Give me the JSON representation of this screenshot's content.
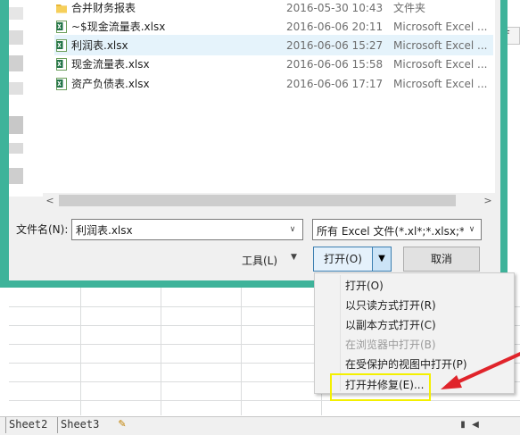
{
  "file_list": {
    "files": [
      {
        "name": "合并财务报表",
        "date": "2016-05-30 10:43",
        "type": "文件夹",
        "icon": "folder-icon"
      },
      {
        "name": "~$现金流量表.xlsx",
        "date": "2016-06-06 20:11",
        "type": "Microsoft Excel ...",
        "icon": "excel-file-icon"
      },
      {
        "name": "利润表.xlsx",
        "date": "2016-06-06 15:27",
        "type": "Microsoft Excel ...",
        "icon": "excel-file-icon"
      },
      {
        "name": "现金流量表.xlsx",
        "date": "2016-06-06 15:58",
        "type": "Microsoft Excel ...",
        "icon": "excel-file-icon"
      },
      {
        "name": "资产负债表.xlsx",
        "date": "2016-06-06 17:17",
        "type": "Microsoft Excel ...",
        "icon": "excel-file-icon"
      }
    ],
    "selected_index": 2
  },
  "scrollbar": {
    "left_arrow": "<",
    "right_arrow": ">"
  },
  "filename": {
    "label": "文件名(N):",
    "value": "利润表.xlsx"
  },
  "filter": {
    "value": "所有 Excel 文件(*.xl*;*.xlsx;*.xl"
  },
  "buttons": {
    "tools": "工具(L)",
    "open": "打开(O)",
    "cancel": "取消"
  },
  "menu": {
    "items": [
      {
        "label": "打开(O)",
        "enabled": true
      },
      {
        "label": "以只读方式打开(R)",
        "enabled": true
      },
      {
        "label": "以副本方式打开(C)",
        "enabled": true
      },
      {
        "label": "在浏览器中打开(B)",
        "enabled": false
      },
      {
        "label": "在受保护的视图中打开(P)",
        "enabled": true
      },
      {
        "label": "打开并修复(E)...",
        "enabled": true
      }
    ]
  },
  "sheet": {
    "column_fragment": "F"
  },
  "tabs": {
    "items": [
      "Sheet2",
      "Sheet3"
    ]
  },
  "colors": {
    "dialog_frame": "#3eb39a",
    "highlight": "#f4f000",
    "arrow": "#e0242b",
    "selected_row": "#e5f3fb"
  }
}
